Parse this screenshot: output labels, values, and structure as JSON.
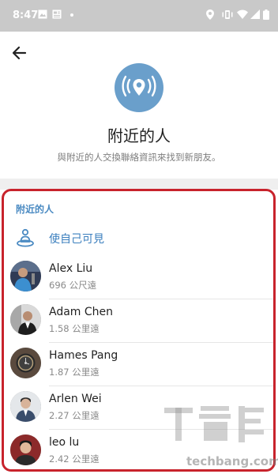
{
  "status_bar": {
    "time": "8:47",
    "left_icons": [
      "image-icon",
      "news-icon",
      "dot-icon"
    ],
    "right_icons": [
      "location-icon",
      "vibrate-icon",
      "wifi-icon",
      "signal-icon",
      "battery-icon"
    ]
  },
  "toolbar": {
    "back_icon": "arrow-left-icon"
  },
  "hero": {
    "icon": "location-broadcast-icon",
    "title": "附近的人",
    "subtitle": "與附近的人交換聯絡資訊來找到新朋友。"
  },
  "section": {
    "header": "附近的人",
    "make_visible_label": "使自己可見",
    "people": [
      {
        "name": "Alex Liu",
        "distance": "696 公尺遠"
      },
      {
        "name": "Adam Chen",
        "distance": "1.58 公里遠"
      },
      {
        "name": "Hames Pang",
        "distance": "1.87 公里遠"
      },
      {
        "name": "Arlen Wei",
        "distance": "2.27 公里遠"
      },
      {
        "name": "leo lu",
        "distance": "2.42 公里遠"
      }
    ]
  },
  "colors": {
    "accent": "#4a8ac2",
    "hero_circle": "#6a9fcb",
    "highlight_border": "#c8232c",
    "status_bar": "#c9c9c9"
  },
  "watermark": {
    "text": "techbang.com"
  }
}
